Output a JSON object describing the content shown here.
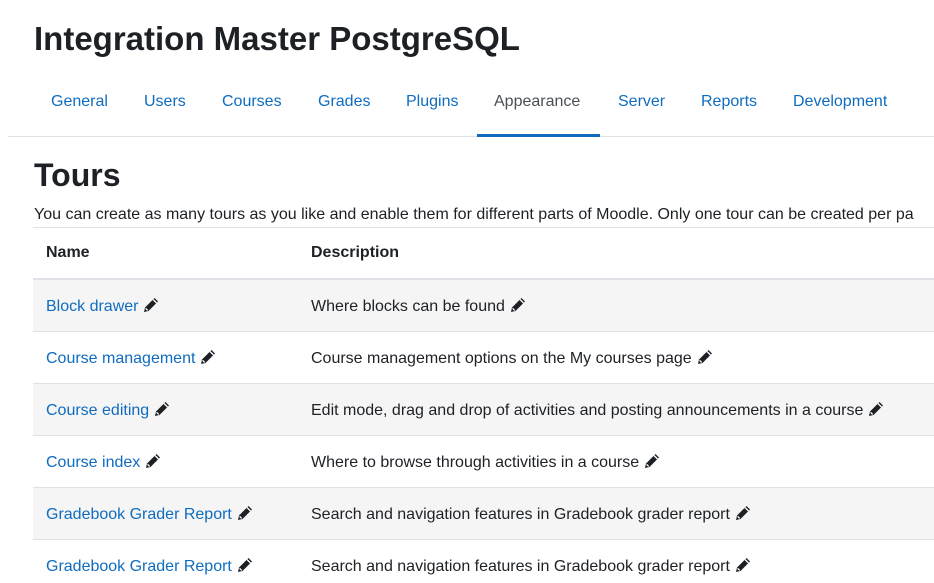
{
  "site": {
    "title": "Integration Master PostgreSQL"
  },
  "nav": {
    "tabs": [
      {
        "label": "General"
      },
      {
        "label": "Users"
      },
      {
        "label": "Courses"
      },
      {
        "label": "Grades"
      },
      {
        "label": "Plugins"
      },
      {
        "label": "Appearance",
        "active": true
      },
      {
        "label": "Server"
      },
      {
        "label": "Reports"
      },
      {
        "label": "Development"
      }
    ]
  },
  "page": {
    "heading": "Tours",
    "intro": "You can create as many tours as you like and enable them for different parts of Moodle. Only one tour can be created per pa"
  },
  "table": {
    "headers": {
      "name": "Name",
      "description": "Description"
    },
    "rows": [
      {
        "name": "Block drawer",
        "description": "Where blocks can be found"
      },
      {
        "name": "Course management",
        "description": "Course management options on the My courses page"
      },
      {
        "name": "Course editing",
        "description": "Edit mode, drag and drop of activities and posting announcements in a course"
      },
      {
        "name": "Course index",
        "description": "Where to browse through activities in a course"
      },
      {
        "name": "Gradebook Grader Report",
        "description": "Search and navigation features in Gradebook grader report"
      },
      {
        "name": "Gradebook Grader Report",
        "description": "Search and navigation features in Gradebook grader report"
      }
    ]
  },
  "icons": {
    "edit": "pencil-icon"
  },
  "colors": {
    "link": "#0f6cbf",
    "active_tab_underline": "#0f6cbf",
    "striped_row": "#f5f5f5",
    "text": "#1d2125"
  }
}
